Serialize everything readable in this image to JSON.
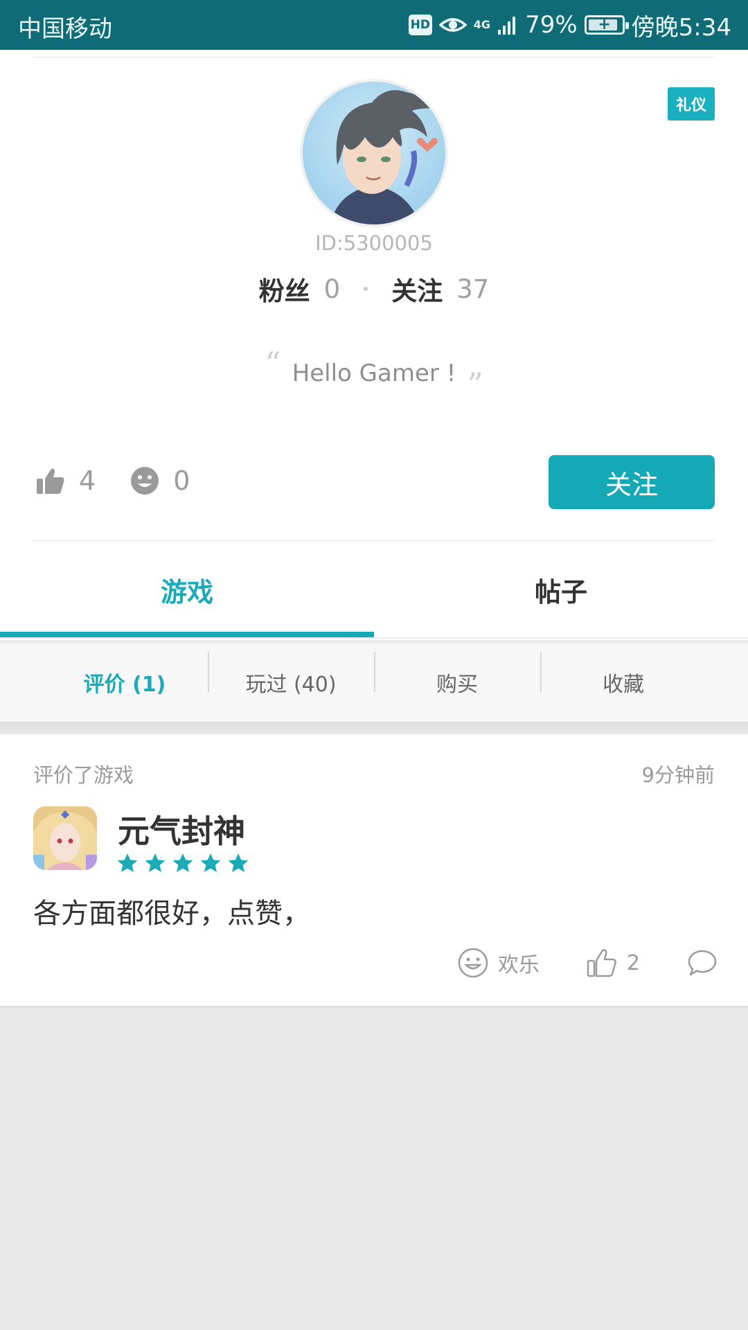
{
  "status_bar": {
    "carrier": "中国移动",
    "hd": "HD",
    "network": "4G",
    "battery": "79%",
    "time": "傍晚5:34"
  },
  "profile": {
    "badge": "礼仪",
    "user_id": "ID:5300005",
    "fans_label": "粉丝",
    "fans_count": "0",
    "following_label": "关注",
    "following_count": "37",
    "quote_open": "“",
    "signature": "Hello Gamer !",
    "quote_close": "”",
    "likes": "4",
    "fun": "0",
    "follow_button": "关注"
  },
  "tabs": [
    {
      "label": "游戏",
      "active": true
    },
    {
      "label": "帖子",
      "active": false
    }
  ],
  "sub_tabs": [
    {
      "label": "评价 (1)",
      "active": true
    },
    {
      "label": "玩过 (40)",
      "active": false
    },
    {
      "label": "购买",
      "active": false
    },
    {
      "label": "收藏",
      "active": false
    }
  ],
  "review": {
    "action": "评价了游戏",
    "time": "9分钟前",
    "game_name": "元气封神",
    "rating": 5,
    "comment": "各方面都很好，点赞，",
    "fun_label": "欢乐",
    "like_count": "2"
  },
  "colors": {
    "accent": "#15a8b6",
    "status_bar": "#0f6b75"
  }
}
